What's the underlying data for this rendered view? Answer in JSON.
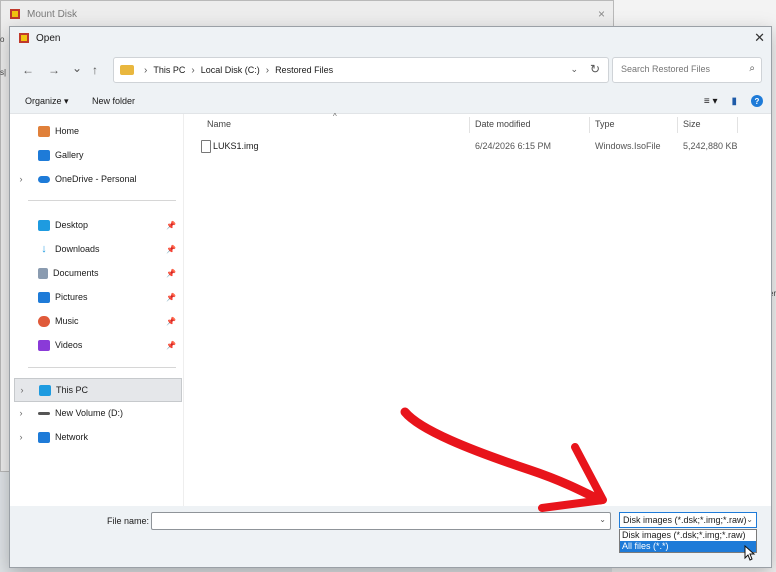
{
  "background_window": {
    "title": "Mount Disk",
    "close_glyph": "×",
    "left_text_1": "o",
    "left_text_2": "s|",
    "right_text": "er"
  },
  "dialog": {
    "title": "Open",
    "close_glyph": "✕",
    "nav": {
      "back": "←",
      "forward": "→",
      "recent": "⌄",
      "up": "↑"
    },
    "breadcrumb": [
      {
        "label": "This PC"
      },
      {
        "label": "Local Disk (C:)"
      },
      {
        "label": "Restored Files"
      }
    ],
    "breadcrumb_sep": "›",
    "address_dropdown": "⌄",
    "refresh": "↻",
    "search": {
      "placeholder": "Search Restored Files",
      "icon": "⌕"
    },
    "toolbar": {
      "organize": "Organize ▾",
      "new_folder": "New folder",
      "view_menu": "≡ ▾",
      "preview_pane": "▮",
      "help": "?"
    },
    "sidebar": {
      "quick": [
        {
          "label": "Home",
          "icon": "home-icon",
          "color": "#e0803a"
        },
        {
          "label": "Gallery",
          "icon": "gallery-icon",
          "color": "#1e7bd8"
        },
        {
          "label": "OneDrive - Personal",
          "icon": "cloud-icon",
          "color": "#1e7bd8",
          "expandable": true
        }
      ],
      "pinned": [
        {
          "label": "Desktop",
          "icon": "desktop-icon",
          "color": "#1e9be0"
        },
        {
          "label": "Downloads",
          "icon": "download-icon",
          "color": "#1e9be0"
        },
        {
          "label": "Documents",
          "icon": "documents-icon",
          "color": "#8a9bb0"
        },
        {
          "label": "Pictures",
          "icon": "pictures-icon",
          "color": "#1e7bd8"
        },
        {
          "label": "Music",
          "icon": "music-icon",
          "color": "#e05a3a"
        },
        {
          "label": "Videos",
          "icon": "videos-icon",
          "color": "#8a3ad8"
        }
      ],
      "pin_glyph": "📌",
      "drives": [
        {
          "label": "This PC",
          "icon": "pc-icon",
          "color": "#1e9be0",
          "selected": true
        },
        {
          "label": "New Volume (D:)",
          "icon": "drive-icon",
          "color": "#555555"
        },
        {
          "label": "Network",
          "icon": "network-icon",
          "color": "#1e7bd8"
        }
      ],
      "chevron": "›"
    },
    "columns": {
      "name": "Name",
      "date": "Date modified",
      "type": "Type",
      "size": "Size",
      "sort_caret": "^"
    },
    "files": [
      {
        "name": "LUKS1.img",
        "date": "6/24/2026 6:15 PM",
        "type": "Windows.IsoFile",
        "size": "5,242,880 KB"
      }
    ],
    "bottom": {
      "file_name_label": "File name:",
      "file_name_value": "",
      "file_type_selected": "Disk images (*.dsk;*.img;*.raw)",
      "file_type_options": [
        {
          "label": "Disk images (*.dsk;*.img;*.raw)",
          "highlighted": false
        },
        {
          "label": "All files (*.*)",
          "highlighted": true
        }
      ],
      "dropdown_glyph": "⌄"
    }
  },
  "colors": {
    "accent": "#1e7bd8",
    "annotation_arrow": "#e8141b"
  }
}
